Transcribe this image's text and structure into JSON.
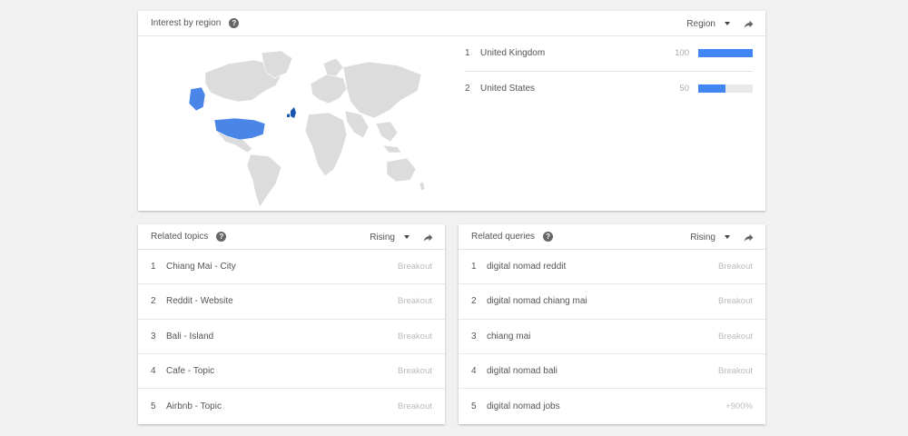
{
  "region_card": {
    "title": "Interest by region",
    "dropdown_label": "Region",
    "regions": [
      {
        "index": "1",
        "name": "United Kingdom",
        "score": "100",
        "fill": 1.0
      },
      {
        "index": "2",
        "name": "United States",
        "score": "50",
        "fill": 0.5
      }
    ]
  },
  "topics_card": {
    "title": "Related topics",
    "dropdown_label": "Rising",
    "items": [
      {
        "index": "1",
        "label": "Chiang Mai - City",
        "value": "Breakout"
      },
      {
        "index": "2",
        "label": "Reddit - Website",
        "value": "Breakout"
      },
      {
        "index": "3",
        "label": "Bali - Island",
        "value": "Breakout"
      },
      {
        "index": "4",
        "label": "Cafe - Topic",
        "value": "Breakout"
      },
      {
        "index": "5",
        "label": "Airbnb - Topic",
        "value": "Breakout"
      }
    ]
  },
  "queries_card": {
    "title": "Related queries",
    "dropdown_label": "Rising",
    "items": [
      {
        "index": "1",
        "label": "digital nomad reddit",
        "value": "Breakout"
      },
      {
        "index": "2",
        "label": "digital nomad chiang mai",
        "value": "Breakout"
      },
      {
        "index": "3",
        "label": "chiang mai",
        "value": "Breakout"
      },
      {
        "index": "4",
        "label": "digital nomad bali",
        "value": "Breakout"
      },
      {
        "index": "5",
        "label": "digital nomad jobs",
        "value": "+900%"
      }
    ]
  },
  "colors": {
    "accent": "#4285f4",
    "map_land": "#dcdcdc",
    "map_highlight_uk": "#1a56b0",
    "map_highlight_us": "#4a86e8"
  },
  "icons": {
    "help": "?",
    "share": "share-icon",
    "caret": "caret-down-icon"
  }
}
